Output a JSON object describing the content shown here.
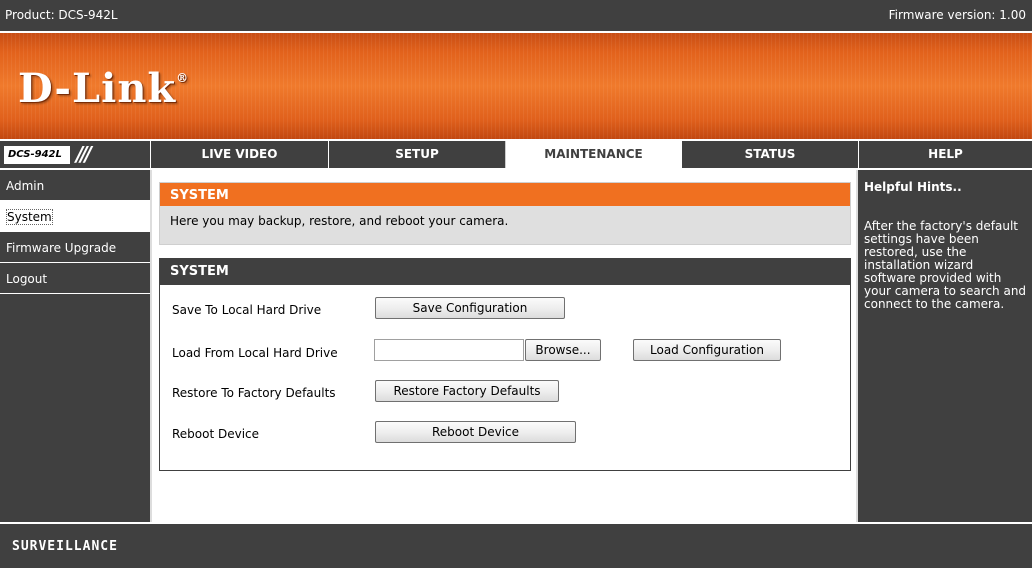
{
  "topbar": {
    "product": "Product: DCS-942L",
    "firmware": "Firmware version: 1.00"
  },
  "banner": {
    "logo_text": "D-Link",
    "logo_reg": "®"
  },
  "nav": {
    "model": "DCS-942L",
    "slashes": "///",
    "tabs": [
      {
        "label": "LIVE VIDEO"
      },
      {
        "label": "SETUP"
      },
      {
        "label": "MAINTENANCE",
        "active": true
      },
      {
        "label": "STATUS"
      },
      {
        "label": "HELP"
      }
    ]
  },
  "sidebar": {
    "items": [
      {
        "label": "Admin"
      },
      {
        "label": "System",
        "active": true
      },
      {
        "label": "Firmware Upgrade"
      },
      {
        "label": "Logout"
      }
    ]
  },
  "main": {
    "section1": {
      "title": "SYSTEM",
      "description": "Here you may backup, restore, and reboot your camera."
    },
    "section2": {
      "title": "SYSTEM",
      "rows": {
        "save": {
          "label": "Save To Local Hard Drive",
          "button": "Save Configuration"
        },
        "load": {
          "label": "Load From Local Hard Drive",
          "input_value": "",
          "browse": "Browse...",
          "button": "Load Configuration"
        },
        "restore": {
          "label": "Restore To Factory Defaults",
          "button": "Restore Factory Defaults"
        },
        "reboot": {
          "label": "Reboot Device",
          "button": "Reboot Device"
        }
      }
    }
  },
  "help": {
    "title": "Helpful Hints..",
    "text": "After the factory's default settings have been restored, use the installation wizard software provided with your camera to search and connect to the camera."
  },
  "footer": {
    "brand": "SURVEILLANCE"
  },
  "colors": {
    "dark": "#404040",
    "accent_orange": "#f07020",
    "panel_gray": "#dfdfdf"
  }
}
